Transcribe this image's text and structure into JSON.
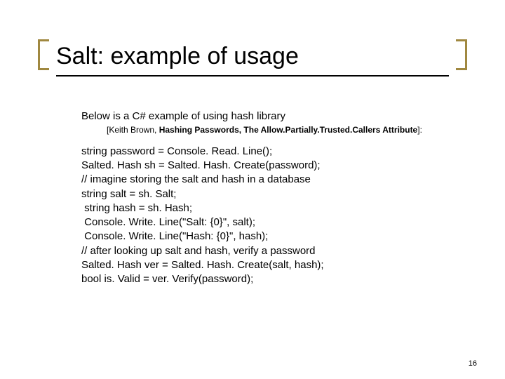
{
  "title": "Salt: example of usage",
  "intro": "Below is a C# example of using hash library",
  "citation_prefix": "[Keith Brown, ",
  "citation_bold": "Hashing Passwords, The Allow.Partially.Trusted.Callers Attribute",
  "citation_suffix": "]:",
  "code": {
    "l1": "string password = Console. Read. Line();",
    "l2": "Salted. Hash sh = Salted. Hash. Create(password);",
    "l3": "// imagine storing the salt and hash in a database",
    "l4": "string salt = sh. Salt;",
    "l5": " string hash = sh. Hash;",
    "l6": " Console. Write. Line(\"Salt: {0}\", salt);",
    "l7": " Console. Write. Line(\"Hash: {0}\", hash);",
    "l8": "// after looking up salt and hash, verify a password",
    "l9": "Salted. Hash ver = Salted. Hash. Create(salt, hash);",
    "l10": "bool is. Valid = ver. Verify(password);"
  },
  "page_number": "16"
}
